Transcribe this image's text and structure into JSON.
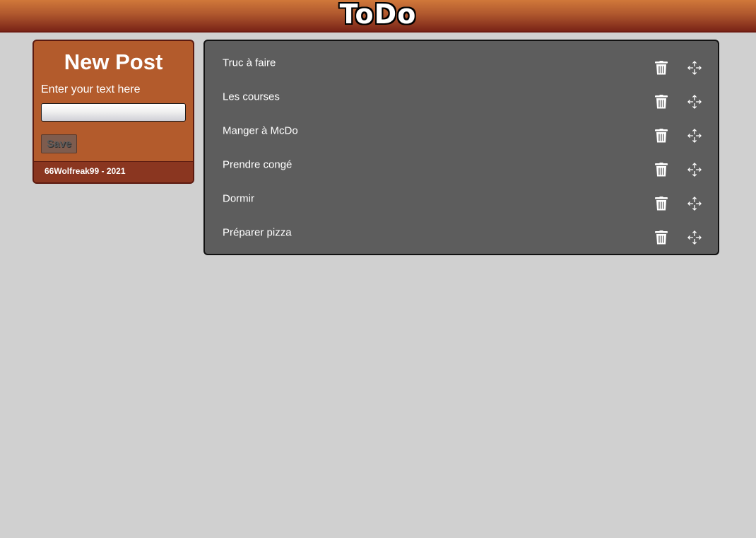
{
  "header": {
    "title": "ToDo"
  },
  "new_post": {
    "title": "New Post",
    "prompt": "Enter your text here",
    "input_value": "",
    "save_label": "Save",
    "footer": "66Wolfreak99 - 2021"
  },
  "todos": [
    {
      "label": "Truc à faire"
    },
    {
      "label": "Les courses"
    },
    {
      "label": "Manger à McDo"
    },
    {
      "label": "Prendre congé"
    },
    {
      "label": "Dormir"
    },
    {
      "label": "Préparer pizza"
    }
  ],
  "icons": {
    "delete": "trash-icon",
    "reorder": "move-icon"
  },
  "colors": {
    "header_top": "#d0783a",
    "header_bottom": "#7a2417",
    "card_background": "#b35b2c",
    "card_footer": "#8a3620",
    "list_background": "#5d5d5d",
    "page_background": "#d0d0d0"
  }
}
